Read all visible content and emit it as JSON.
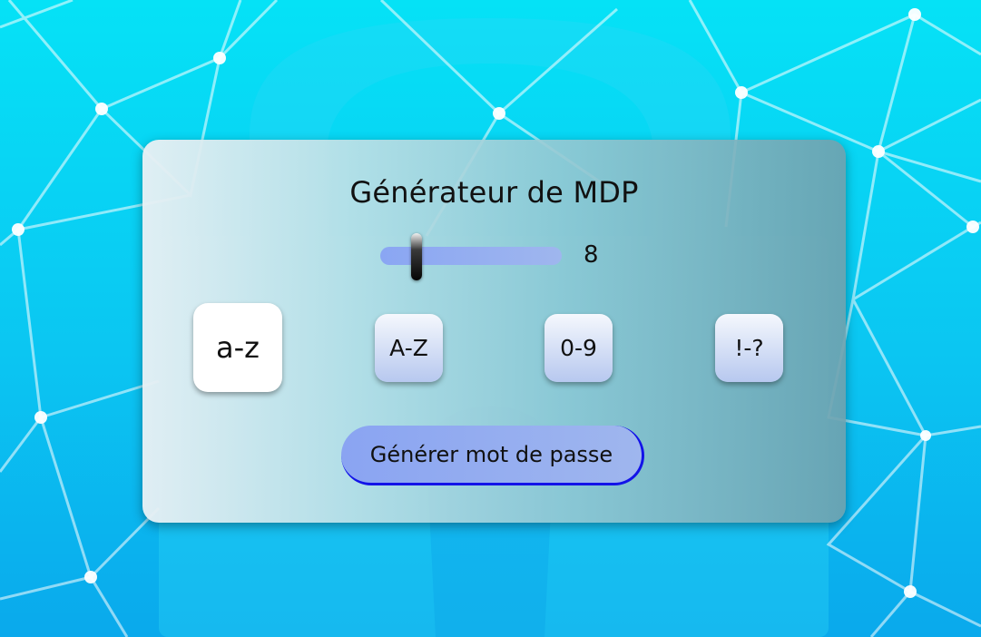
{
  "app": {
    "title": "Générateur de MDP"
  },
  "length_slider": {
    "value": "8",
    "fill_fraction": 0.2
  },
  "options": [
    {
      "label": "a-z",
      "active": true
    },
    {
      "label": "A-Z",
      "active": false
    },
    {
      "label": "0-9",
      "active": false
    },
    {
      "label": "!-?",
      "active": false
    }
  ],
  "generate_button": {
    "label": "Générer mot de passe"
  },
  "colors": {
    "background": "#0bc6f2",
    "slider_track": "#8aa6f3",
    "button_fill": "#8aa4f2",
    "button_border": "#1313e8"
  }
}
